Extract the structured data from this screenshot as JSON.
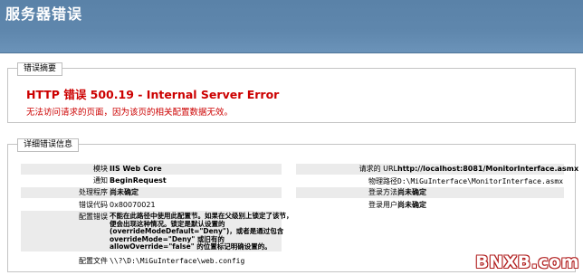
{
  "banner": {
    "title": "服务器错误"
  },
  "summary": {
    "header": "错误摘要",
    "http_title": "HTTP 错误 500.19 - Internal Server Error",
    "description": "无法访问请求的页面，因为该页的相关配置数据无效。"
  },
  "details": {
    "header": "详细错误信息",
    "left": {
      "module_label": "模块",
      "module_value": "IIS Web Core",
      "notification_label": "通知",
      "notification_value": "BeginRequest",
      "handler_label": "处理程序",
      "handler_value": "尚未确定",
      "error_code_label": "错误代码",
      "error_code_value": "0x80070021",
      "config_error_label": "配置错误",
      "config_error_value": "不能在此路径中使用此配置节。如果在父级别上锁定了该节，便会出现这种情况。锁定是默认设置的(overrideModeDefault=\"Deny\")，或者是通过包含 overrideMode=\"Deny\" 或旧有的 allowOverride=\"false\" 的位置标记明确设置的。",
      "config_file_label": "配置文件",
      "config_file_value": "\\\\?\\D:\\MiGuInterface\\web.config"
    },
    "right": {
      "url_label": "请求的 URL",
      "url_value": "http://localhost:8081/MonitorInterface.asmx",
      "physical_path_label": "物理路径",
      "physical_path_value": "D:\\MiGuInterface\\MonitorInterface.asmx",
      "logon_method_label": "登录方法",
      "logon_method_value": "尚未确定",
      "logon_user_label": "登录用户",
      "logon_user_value": "尚未确定"
    }
  },
  "watermark": "BNXB.com"
}
